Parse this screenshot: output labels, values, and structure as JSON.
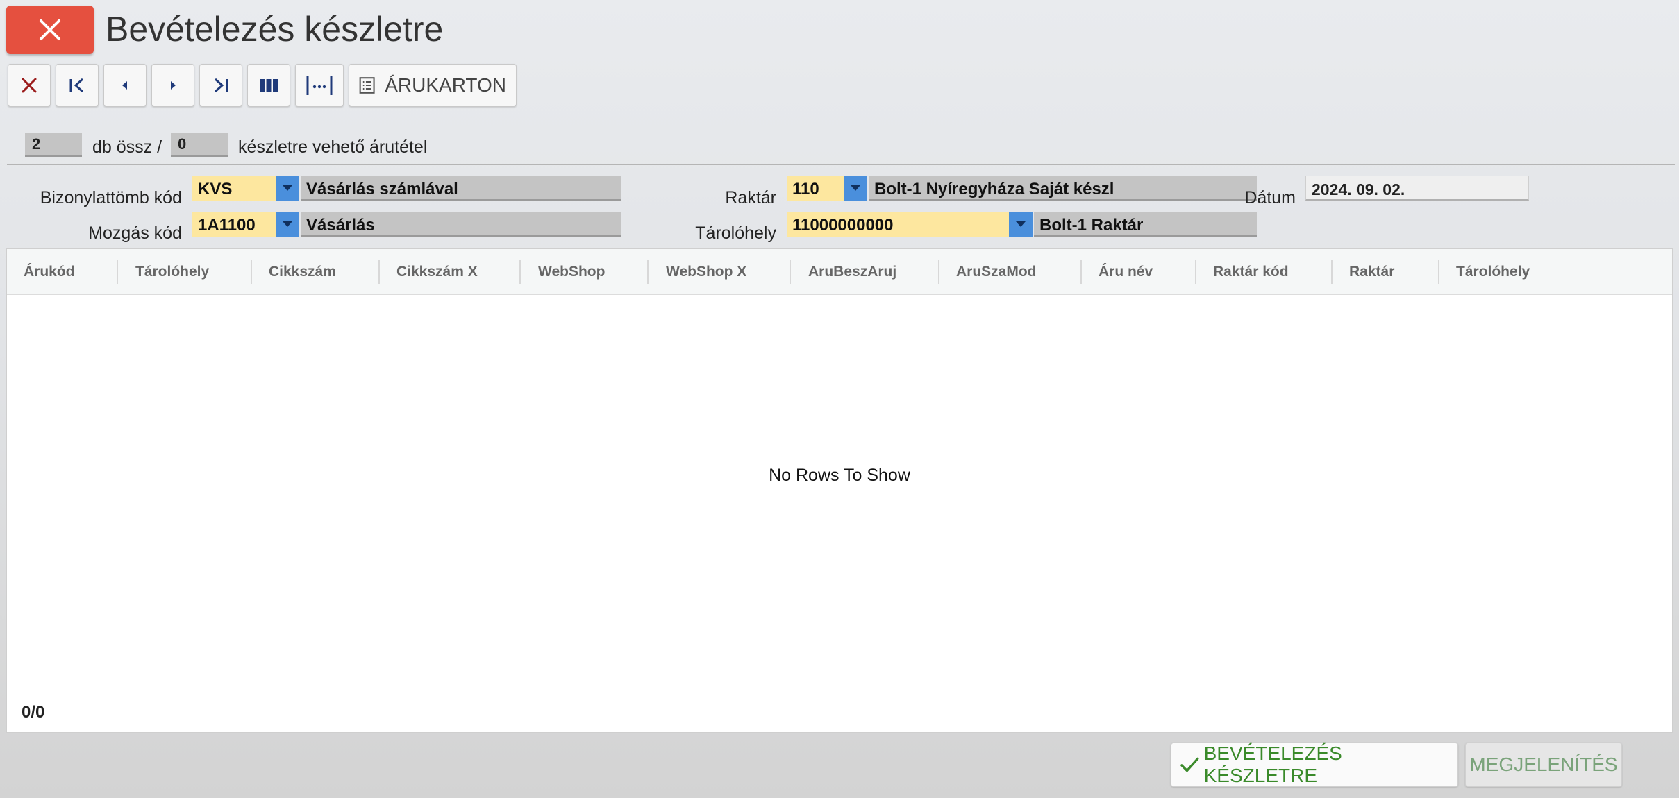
{
  "title": "Bevételezés készletre",
  "toolbar": {
    "arukarton_label": "ÁRUKARTON"
  },
  "counters": {
    "total": "2",
    "total_text": "db össz /",
    "available": "0",
    "available_text": "készletre vehető árutétel"
  },
  "form": {
    "bizonylattomb": {
      "label": "Bizonylattömb kód",
      "code": "KVS",
      "desc": "Vásárlás számlával"
    },
    "mozgas": {
      "label": "Mozgás kód",
      "code": "1A1100",
      "desc": "Vásárlás"
    },
    "raktar": {
      "label": "Raktár",
      "code": "110",
      "desc": "Bolt-1 Nyíregyháza Saját készl"
    },
    "tarolohely": {
      "label": "Tárolóhely",
      "code": "11000000000",
      "desc": "Bolt-1 Raktár"
    },
    "datum": {
      "label": "Dátum",
      "value": "2024. 09. 02."
    }
  },
  "grid": {
    "columns": [
      "Árukód",
      "Tárolóhely",
      "Cikkszám",
      "Cikkszám X",
      "WebShop",
      "WebShop X",
      "AruBeszAruj",
      "AruSzaMod",
      "Áru név",
      "Raktár kód",
      "Raktár",
      "Tárolóhely"
    ],
    "empty_text": "No Rows To Show",
    "footer": "0/0"
  },
  "actions": {
    "bevetelezes": "BEVÉTELEZÉS KÉSZLETRE",
    "megjelenites": "MEGJELENÍTÉS"
  },
  "colors": {
    "close_red": "#e5503f",
    "code_yellow": "#fde79f",
    "dropdown_blue": "#4a8fdc",
    "action_green": "#3a8a2a",
    "icon_navy": "#1f3a7a"
  }
}
